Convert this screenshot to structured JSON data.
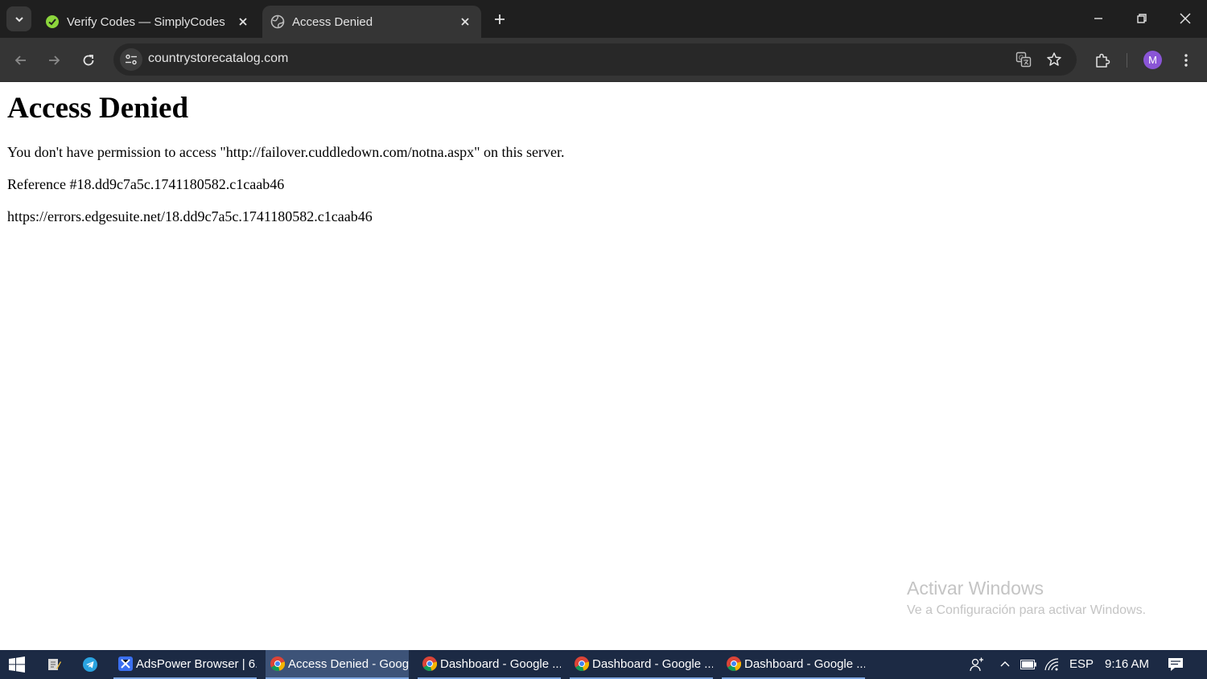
{
  "browser": {
    "tabs": [
      {
        "title": "Verify Codes — SimplyCodes",
        "icon": "simplycodes-icon",
        "active": false
      },
      {
        "title": "Access Denied",
        "icon": "globe-icon",
        "active": true
      }
    ],
    "address": "countrystorecatalog.com",
    "profile_initial": "M"
  },
  "page": {
    "heading": "Access Denied",
    "message": "You don't have permission to access \"http://failover.cuddledown.com/notna.aspx\" on this server.",
    "reference": "Reference #18.dd9c7a5c.1741180582.c1caab46",
    "error_url": "https://errors.edgesuite.net/18.dd9c7a5c.1741180582.c1caab46"
  },
  "watermark": {
    "title": "Activar Windows",
    "subtitle": "Ve a Configuración para activar Windows."
  },
  "taskbar": {
    "apps": [
      {
        "label": "AdsPower Browser | 6....",
        "icon": "adspower-icon",
        "active": false
      },
      {
        "label": "Access Denied - Goog...",
        "icon": "chrome-icon",
        "active": true
      },
      {
        "label": "Dashboard - Google ...",
        "icon": "chrome-icon",
        "active": false
      },
      {
        "label": "Dashboard - Google ...",
        "icon": "chrome-icon",
        "active": false
      },
      {
        "label": "Dashboard - Google ...",
        "icon": "chrome-icon",
        "active": false
      }
    ],
    "language": "ESP",
    "time": "9:16 AM"
  },
  "colors": {
    "chrome_dark": "#1f1f1f",
    "toolbar": "#353535",
    "taskbar": "#1c2a44",
    "avatar": "#8a55d6",
    "simplycodes_green": "#8cd63c"
  }
}
